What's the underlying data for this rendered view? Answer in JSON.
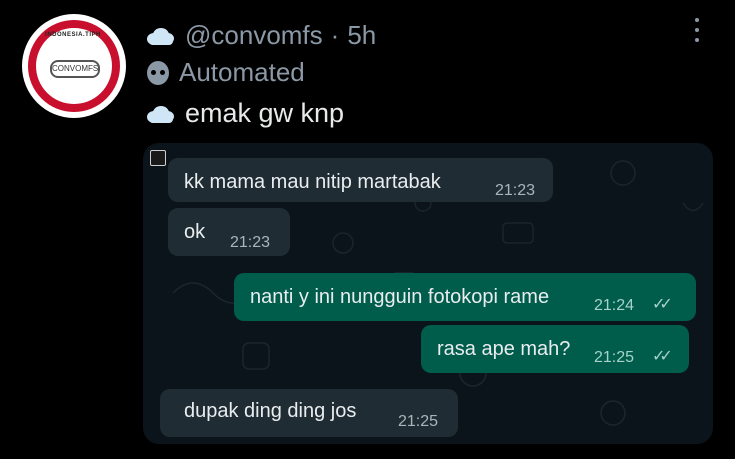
{
  "profile": {
    "avatar_text": "CONVOMFS",
    "avatar_arc_text": "INDONESIA.TIPH"
  },
  "tweet": {
    "handle": "@convomfs",
    "separator": "·",
    "time": "5h",
    "automated_label": "Automated",
    "text": "emak gw knp"
  },
  "chat": {
    "messages": [
      {
        "direction": "in",
        "text": "kk mama mau nitip martabak",
        "time": "21:23"
      },
      {
        "direction": "in",
        "text": "ok",
        "time": "21:23"
      },
      {
        "direction": "out",
        "text": "nanti y ini nungguin fotokopi rame",
        "time": "21:24",
        "status": "read"
      },
      {
        "direction": "out",
        "text": "rasa ape mah?",
        "time": "21:25",
        "status": "read"
      },
      {
        "direction": "in",
        "text": "dupak ding ding jos",
        "time": "21:25"
      }
    ],
    "colors": {
      "background": "#0b141a",
      "incoming": "#202c33",
      "outgoing": "#005c4b"
    }
  },
  "icons": {
    "menu": "more-vertical-icon",
    "bot": "robot-icon",
    "cloud": "cloud-emoji-icon",
    "read_ticks": "double-check-icon"
  }
}
